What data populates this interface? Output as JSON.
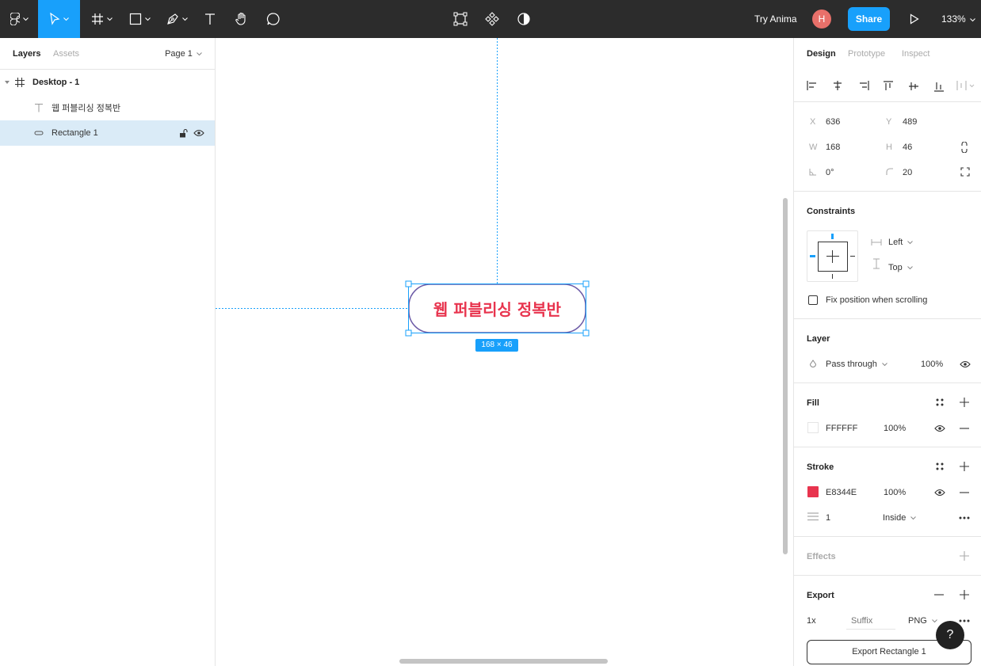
{
  "toolbar": {
    "try_anima": "Try Anima",
    "avatar_initial": "H",
    "share_label": "Share",
    "zoom": "133%"
  },
  "left_panel": {
    "tab_layers": "Layers",
    "tab_assets": "Assets",
    "page": "Page 1",
    "layers": [
      {
        "name": "Desktop - 1",
        "icon": "frame-icon"
      },
      {
        "name": "웹 퍼블리싱 정복반",
        "icon": "text-layer-icon"
      },
      {
        "name": "Rectangle 1",
        "icon": "rectangle-layer-icon",
        "selected": true
      }
    ]
  },
  "canvas": {
    "button_text": "웹 퍼블리싱 정복반",
    "size_badge": "168 × 46",
    "text_color": "#E8344E"
  },
  "right_panel": {
    "tabs": [
      "Design",
      "Prototype",
      "Inspect"
    ],
    "x_label": "X",
    "x_value": "636",
    "y_label": "Y",
    "y_value": "489",
    "w_label": "W",
    "w_value": "168",
    "h_label": "H",
    "h_value": "46",
    "rotation": "0°",
    "radius": "20",
    "constraints_title": "Constraints",
    "constraint_h": "Left",
    "constraint_v": "Top",
    "fix_position": "Fix position when scrolling",
    "layer_title": "Layer",
    "blend_mode": "Pass through",
    "layer_opacity": "100%",
    "fill_title": "Fill",
    "fill_hex": "FFFFFF",
    "fill_opacity": "100%",
    "stroke_title": "Stroke",
    "stroke_hex": "E8344E",
    "stroke_color": "#E8344E",
    "stroke_opacity": "100%",
    "stroke_weight": "1",
    "stroke_align": "Inside",
    "effects_title": "Effects",
    "export_title": "Export",
    "export_scale": "1x",
    "export_suffix_placeholder": "Suffix",
    "export_format": "PNG",
    "export_button": "Export Rectangle 1",
    "help": "?"
  }
}
